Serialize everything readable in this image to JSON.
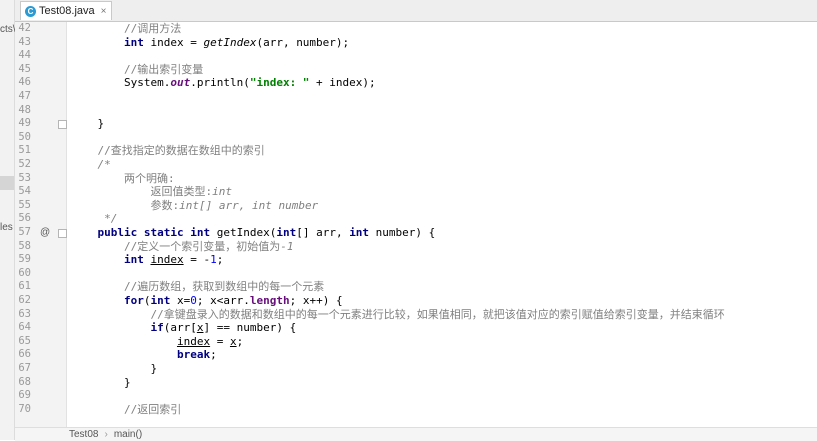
{
  "sidebar_fragments": [
    "cts\\",
    "les"
  ],
  "tab": {
    "filename": "Test08.java",
    "icon_letter": "C",
    "close": "×"
  },
  "lines": [
    {
      "n": "42",
      "parts": [
        {
          "t": "        "
        },
        {
          "t": "//调用方法",
          "c": "cm"
        }
      ]
    },
    {
      "n": "43",
      "parts": [
        {
          "t": "        "
        },
        {
          "t": "int",
          "c": "kw"
        },
        {
          "t": " index = "
        },
        {
          "t": "getIndex",
          "c": "it"
        },
        {
          "t": "(arr, number);"
        }
      ]
    },
    {
      "n": "44",
      "parts": []
    },
    {
      "n": "45",
      "parts": [
        {
          "t": "        "
        },
        {
          "t": "//输出索引变量",
          "c": "cm"
        }
      ]
    },
    {
      "n": "46",
      "parts": [
        {
          "t": "        System."
        },
        {
          "t": "out",
          "c": "fld"
        },
        {
          "t": ".println("
        },
        {
          "t": "\"index: \"",
          "c": "st"
        },
        {
          "t": " + index);"
        }
      ]
    },
    {
      "n": "47",
      "parts": []
    },
    {
      "n": "48",
      "parts": []
    },
    {
      "n": "49",
      "parts": [
        {
          "t": "    }"
        }
      ]
    },
    {
      "n": "50",
      "parts": []
    },
    {
      "n": "51",
      "parts": [
        {
          "t": "    "
        },
        {
          "t": "//查找指定的数据在数组中的索引",
          "c": "cm"
        }
      ]
    },
    {
      "n": "52",
      "parts": [
        {
          "t": "    "
        },
        {
          "t": "/*",
          "c": "cm it"
        }
      ]
    },
    {
      "n": "53",
      "parts": [
        {
          "t": "        "
        },
        {
          "t": "两个明确:",
          "c": "cm"
        }
      ]
    },
    {
      "n": "54",
      "parts": [
        {
          "t": "            "
        },
        {
          "t": "返回值类型:",
          "c": "cm"
        },
        {
          "t": "int",
          "c": "cm it"
        }
      ]
    },
    {
      "n": "55",
      "parts": [
        {
          "t": "            "
        },
        {
          "t": "参数:",
          "c": "cm"
        },
        {
          "t": "int[] arr, int number",
          "c": "cm it"
        }
      ]
    },
    {
      "n": "56",
      "parts": [
        {
          "t": "     "
        },
        {
          "t": "*/",
          "c": "cm it"
        }
      ]
    },
    {
      "n": "57",
      "parts": [
        {
          "t": "    "
        },
        {
          "t": "public static int",
          "c": "kw"
        },
        {
          "t": " getIndex("
        },
        {
          "t": "int",
          "c": "kw"
        },
        {
          "t": "[] arr, "
        },
        {
          "t": "int",
          "c": "kw"
        },
        {
          "t": " number) {"
        }
      ]
    },
    {
      "n": "58",
      "parts": [
        {
          "t": "        "
        },
        {
          "t": "//定义一个索引变量，初始值为",
          "c": "cm"
        },
        {
          "t": "-1",
          "c": "cm it"
        }
      ]
    },
    {
      "n": "59",
      "parts": [
        {
          "t": "        "
        },
        {
          "t": "int",
          "c": "kw"
        },
        {
          "t": " "
        },
        {
          "t": "index",
          "c": "ul"
        },
        {
          "t": " = -"
        },
        {
          "t": "1",
          "c": "num"
        },
        {
          "t": ";"
        }
      ]
    },
    {
      "n": "60",
      "parts": []
    },
    {
      "n": "61",
      "parts": [
        {
          "t": "        "
        },
        {
          "t": "//遍历数组，获取到数组中的每一个元素",
          "c": "cm"
        }
      ]
    },
    {
      "n": "62",
      "parts": [
        {
          "t": "        "
        },
        {
          "t": "for",
          "c": "kw"
        },
        {
          "t": "("
        },
        {
          "t": "int",
          "c": "kw"
        },
        {
          "t": " x="
        },
        {
          "t": "0",
          "c": "num"
        },
        {
          "t": "; x<arr."
        },
        {
          "t": "length",
          "c": "var kw"
        },
        {
          "t": "; x++) {"
        }
      ]
    },
    {
      "n": "63",
      "parts": [
        {
          "t": "            "
        },
        {
          "t": "//拿键盘录入的数据和数组中的每一个元素进行比较，如果值相同，就把该值对应的索引赋值给索引变量，并结束循环",
          "c": "cm"
        }
      ]
    },
    {
      "n": "64",
      "parts": [
        {
          "t": "            "
        },
        {
          "t": "if",
          "c": "kw"
        },
        {
          "t": "(arr["
        },
        {
          "t": "x",
          "c": "ul"
        },
        {
          "t": "] == number) {"
        }
      ]
    },
    {
      "n": "65",
      "parts": [
        {
          "t": "                "
        },
        {
          "t": "index",
          "c": "ul"
        },
        {
          "t": " = "
        },
        {
          "t": "x",
          "c": "ul"
        },
        {
          "t": ";"
        }
      ]
    },
    {
      "n": "66",
      "parts": [
        {
          "t": "                "
        },
        {
          "t": "break",
          "c": "kw"
        },
        {
          "t": ";"
        }
      ]
    },
    {
      "n": "67",
      "parts": [
        {
          "t": "            }"
        }
      ]
    },
    {
      "n": "68",
      "parts": [
        {
          "t": "        }"
        }
      ]
    },
    {
      "n": "69",
      "parts": []
    },
    {
      "n": "70",
      "parts": [
        {
          "t": "        "
        },
        {
          "t": "//返回索引",
          "c": "cm"
        }
      ]
    }
  ],
  "gutter_markers": {
    "57": "@"
  },
  "fold_lines": [
    "49",
    "57"
  ],
  "breadcrumb": [
    "Test08",
    "main()"
  ],
  "breadcrumb_sep": "›"
}
